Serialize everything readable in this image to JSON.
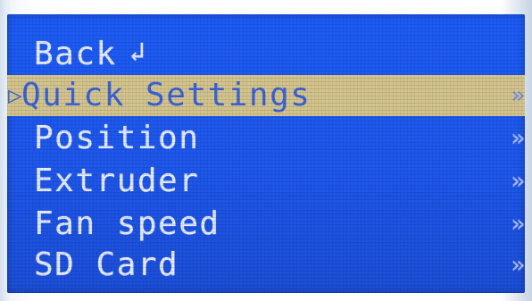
{
  "menu": {
    "back": {
      "label": "Back",
      "icon": "return-arrow-icon",
      "glyph": "↲"
    },
    "items": [
      {
        "label": "Quick Settings",
        "selected": true
      },
      {
        "label": "Position",
        "selected": false
      },
      {
        "label": "Extruder",
        "selected": false
      },
      {
        "label": "Fan speed",
        "selected": false
      },
      {
        "label": "SD Card",
        "selected": false
      }
    ],
    "submenu_glyph": "»",
    "cursor_glyph": "▷"
  },
  "colors": {
    "screen_background": "#1d5cf3",
    "text": "#e6ecff",
    "highlight_background": "#d3c48b",
    "highlight_text": "#3a63d7"
  }
}
